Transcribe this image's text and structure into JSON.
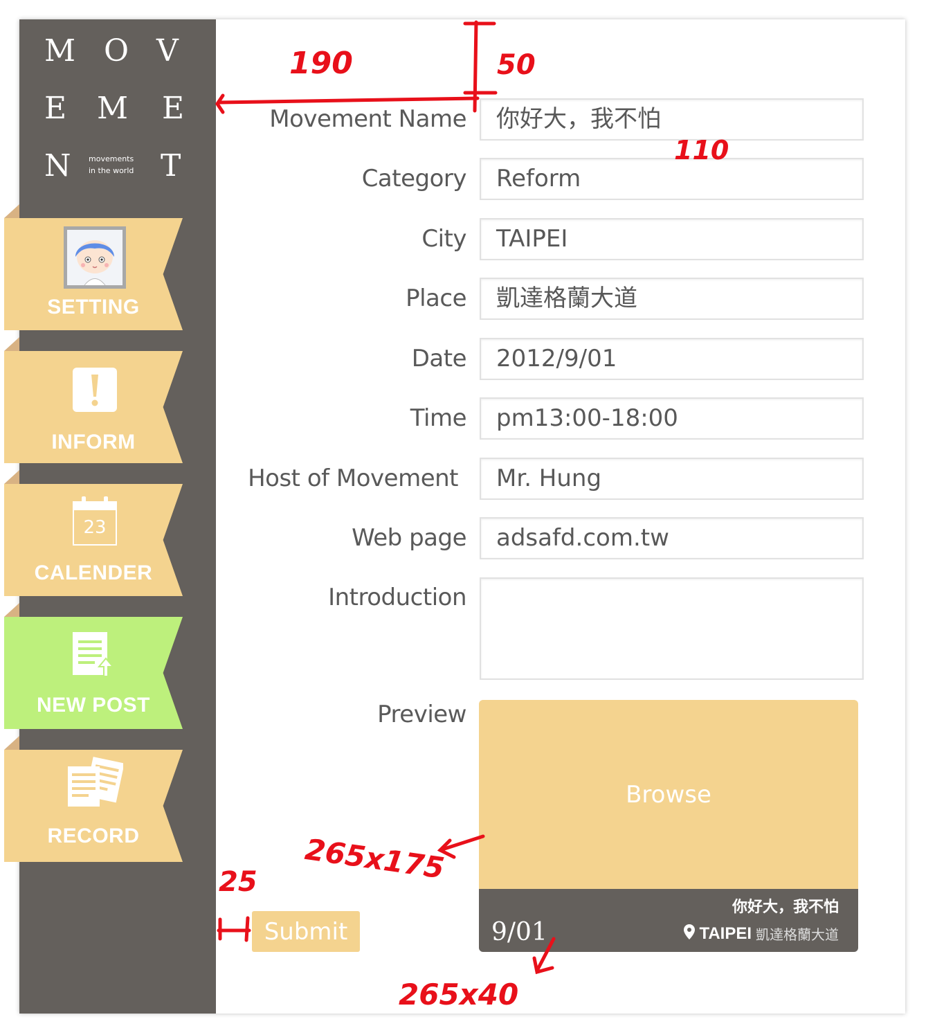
{
  "logo": {
    "letters": [
      "M",
      "O",
      "V",
      "E",
      "M",
      "E",
      "N",
      "T"
    ],
    "tagline_line1": "movements",
    "tagline_line2": "in the world"
  },
  "nav": {
    "items": [
      {
        "label": "SETTING",
        "icon": "avatar-icon",
        "active": false
      },
      {
        "label": "INFORM",
        "icon": "exclamation-icon",
        "active": false
      },
      {
        "label": "CALENDER",
        "icon": "calendar-icon",
        "calendar_day": "23",
        "active": false
      },
      {
        "label": "NEW POST",
        "icon": "new-post-icon",
        "active": true
      },
      {
        "label": "RECORD",
        "icon": "record-icon",
        "active": false
      }
    ]
  },
  "form": {
    "fields": [
      {
        "label": "Movement Name",
        "value": "你好大，我不怕"
      },
      {
        "label": "Category",
        "value": "Reform"
      },
      {
        "label": "City",
        "value": "TAIPEI"
      },
      {
        "label": "Place",
        "value": "凱達格蘭大道"
      },
      {
        "label": "Date",
        "value": "2012/9/01"
      },
      {
        "label": "Time",
        "value": "pm13:00-18:00"
      },
      {
        "label": "Host of Movement",
        "value": "Mr. Hung"
      },
      {
        "label": "Web page",
        "value": "adsafd.com.tw"
      },
      {
        "label": "Introduction",
        "value": ""
      }
    ],
    "preview_label": "Preview",
    "submit_label": "Submit"
  },
  "preview": {
    "browse_label": "Browse",
    "date": "9/01",
    "title": "你好大，我不怕",
    "city": "TAIPEI",
    "place": "凱達格蘭大道"
  },
  "annotations": {
    "a190": "190",
    "a50": "50",
    "a110": "110",
    "a265x175": "265x175",
    "a25": "25",
    "a265x40": "265x40"
  },
  "colors": {
    "sidebar": "#64605c",
    "ribbon": "#f4d38f",
    "ribbon_active": "#bdf07c",
    "annotation": "#e8101a"
  }
}
